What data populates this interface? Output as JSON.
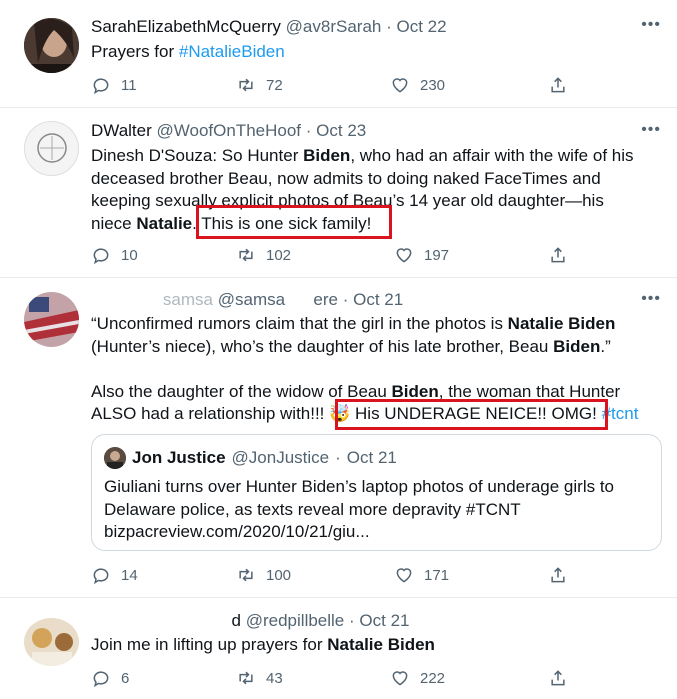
{
  "tweets": [
    {
      "name": "SarahElizabethMcQuerry",
      "handle": "@av8rSarah",
      "dot": "·",
      "time": "Oct 22",
      "text_plain": "Prayers for ",
      "text_tag": "#NatalieBiden",
      "replies": "11",
      "retweets": "72",
      "likes": "230",
      "more": "•••"
    },
    {
      "name": "DWalter",
      "handle": "@WoofOnTheHoof",
      "dot": "·",
      "time": "Oct 23",
      "line1a": "Dinesh D'Souza: So Hunter ",
      "line1b": "Biden",
      "line1c": ", who had an affair with the wife of his",
      "line2": "deceased brother Beau, now admits to doing naked FaceTimes and",
      "line3": "keeping sexually explicit photos of Beau’s 14 year old daughter—his",
      "line4a": "niece ",
      "line4b": "Natalie",
      "line4c": ". This is one sick family!",
      "replies": "10",
      "retweets": "102",
      "likes": "197",
      "more": "•••"
    },
    {
      "name": "samsa",
      "handle": "@samsa      ere",
      "dot": "·",
      "time": "Oct 21",
      "p1a": "“Unconfirmed rumors claim that the girl in the photos is ",
      "p1b": "Natalie Biden",
      "p1c": "(Hunter’s niece), who’s the daughter of his late brother, Beau ",
      "p1d": "Biden",
      "p1e": ".”",
      "p2a": "Also the daughter of the widow of Beau ",
      "p2b": "Biden",
      "p2c": ", the woman that Hunter",
      "p2d": "ALSO had a relationship with!!! ",
      "p2e": "🤯 His UNDERAGE NEICE!! OMG! ",
      "p2f": "#tcnt",
      "quote": {
        "name": "Jon Justice",
        "handle": "@JonJustice",
        "dot": "·",
        "time": "Oct 21",
        "line1": "Giuliani turns over Hunter Biden’s laptop photos of underage girls to",
        "line2": "Delaware police, as texts reveal more depravity #TCNT",
        "line3": "bizpacreview.com/2020/10/21/giu..."
      },
      "replies": "14",
      "retweets": "100",
      "likes": "171",
      "more": "•••"
    },
    {
      "name": "d",
      "handle": "@redpillbelle",
      "dot": "·",
      "time": "Oct 21",
      "text_plain": "Join me in lifting up prayers for ",
      "text_hl": "Natalie Biden",
      "replies": "6",
      "retweets": "43",
      "likes": "222"
    }
  ],
  "colors": {
    "accent": "#1d9bf0",
    "highlight_box": "#d9141f",
    "secondary_text": "#536471"
  }
}
